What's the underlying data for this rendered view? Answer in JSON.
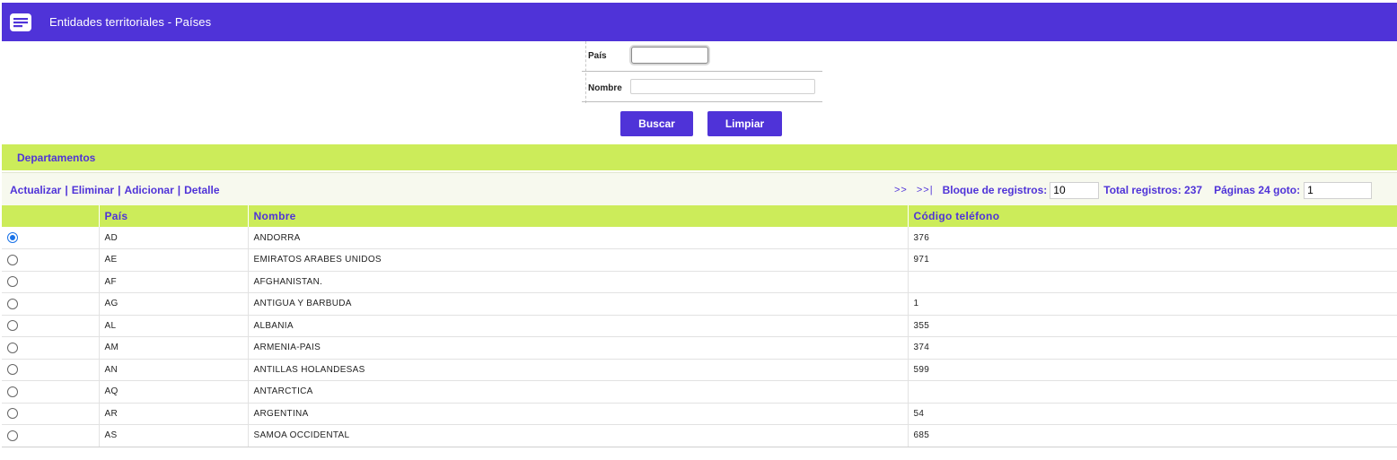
{
  "header": {
    "title": "Entidades territoriales - Países",
    "icon": "list-card-icon"
  },
  "search": {
    "pais_label": "País",
    "pais_value": "",
    "nombre_label": "Nombre",
    "nombre_value": "",
    "buscar_label": "Buscar",
    "limpiar_label": "Limpiar"
  },
  "section": {
    "title": "Departamentos"
  },
  "toolbar": {
    "actions": [
      "Actualizar",
      "Eliminar",
      "Adicionar",
      "Detalle"
    ],
    "separator": "|",
    "next": ">>",
    "last": ">>|",
    "block_label": "Bloque de registros:",
    "block_value": "10",
    "total_label": "Total registros: 237",
    "pages_label": "Páginas 24 goto:",
    "goto_value": "1"
  },
  "table": {
    "columns": [
      "",
      "País",
      "Nombre",
      "Código teléfono"
    ],
    "rows": [
      {
        "selected": true,
        "pais": "AD",
        "nombre": "ANDORRA",
        "codigo": "376"
      },
      {
        "selected": false,
        "pais": "AE",
        "nombre": "EMIRATOS ARABES UNIDOS",
        "codigo": "971"
      },
      {
        "selected": false,
        "pais": "AF",
        "nombre": "AFGHANISTAN.",
        "codigo": ""
      },
      {
        "selected": false,
        "pais": "AG",
        "nombre": "ANTIGUA Y BARBUDA",
        "codigo": "1"
      },
      {
        "selected": false,
        "pais": "AL",
        "nombre": "ALBANIA",
        "codigo": "355"
      },
      {
        "selected": false,
        "pais": "AM",
        "nombre": "ARMENIA-PAIS",
        "codigo": "374"
      },
      {
        "selected": false,
        "pais": "AN",
        "nombre": "ANTILLAS HOLANDESAS",
        "codigo": "599"
      },
      {
        "selected": false,
        "pais": "AQ",
        "nombre": "ANTARCTICA",
        "codigo": ""
      },
      {
        "selected": false,
        "pais": "AR",
        "nombre": "ARGENTINA",
        "codigo": "54"
      },
      {
        "selected": false,
        "pais": "AS",
        "nombre": "SAMOA OCCIDENTAL",
        "codigo": "685"
      }
    ]
  },
  "colors": {
    "primary": "#4f33d8",
    "accent": "#ccec5a",
    "toolbar_bg": "#f7f9ee",
    "radio_selected": "#1a73e8"
  }
}
